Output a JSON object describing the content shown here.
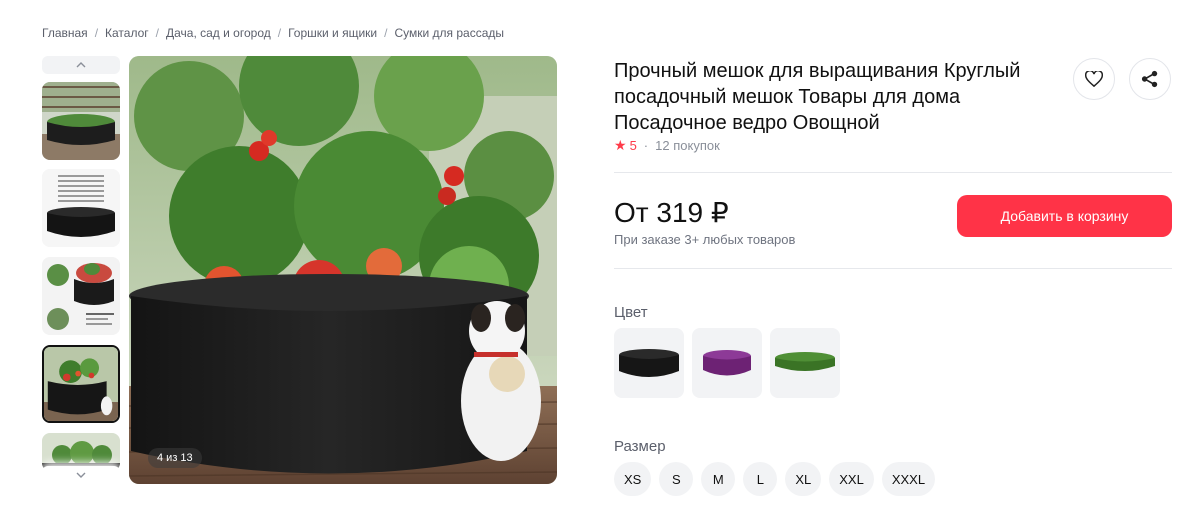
{
  "breadcrumb": [
    "Главная",
    "Каталог",
    "Дача, сад и огород",
    "Горшки и ящики",
    "Сумки для рассады"
  ],
  "breadcrumb_separator": "/",
  "gallery": {
    "counter": "4 из 13",
    "active_index": 4,
    "nav_up_icon": "chevron-up-icon",
    "nav_down_icon": "chevron-down-icon"
  },
  "product": {
    "title": "Прочный мешок для выращивания Круглый посадочный мешок Товары для дома Посадочное ведро Овощной",
    "rating": "5",
    "dot": "·",
    "purchases": "12 покупок",
    "price": "От 319 ₽",
    "price_note": "При заказе 3+ любых товаров",
    "add_to_cart": "Добавить в корзину"
  },
  "actions": {
    "favorite_icon": "heart-icon",
    "share_icon": "share-icon"
  },
  "color": {
    "label": "Цвет",
    "options": [
      {
        "name": "black",
        "hex": "#1c1c1c"
      },
      {
        "name": "purple",
        "hex": "#7a2a84"
      },
      {
        "name": "green",
        "hex": "#3f7d2c"
      }
    ]
  },
  "size": {
    "label": "Размер",
    "options": [
      "XS",
      "S",
      "M",
      "L",
      "XL",
      "XXL",
      "XXXL"
    ]
  },
  "colors": {
    "accent": "#ff3347",
    "star": "#ff3b4a",
    "muted": "#6f7480",
    "chip_bg": "#f2f3f5"
  }
}
